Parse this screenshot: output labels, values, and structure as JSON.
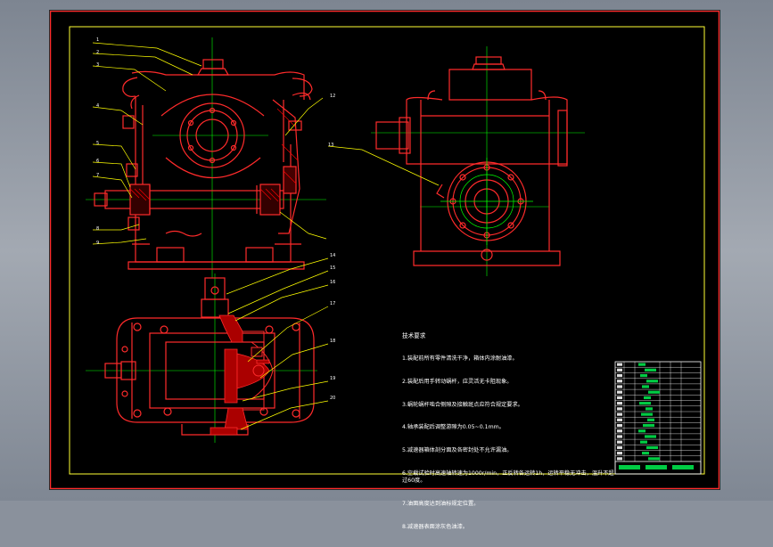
{
  "window": {
    "background": "#8a919c",
    "sheet_color": "#000000",
    "frame_color": "#ff2b2b",
    "border_color": "#ffff33"
  },
  "drawing": {
    "line_colors": {
      "outline": "#ff2b2b",
      "center": "#00ff00",
      "leader": "#ffff00",
      "hatch": "#ff0000",
      "text": "#ffffff"
    }
  },
  "part_numbers_front": [
    "1",
    "2",
    "3",
    "4",
    "5",
    "6",
    "7",
    "8",
    "9"
  ],
  "part_numbers_right": [
    "12",
    "13"
  ],
  "part_numbers_top": [
    "14",
    "15",
    "16",
    "17",
    "18",
    "19",
    "20"
  ],
  "notes": {
    "title": "技术要求",
    "lines": [
      "1.装配前所有零件清洗干净，箱体内涂耐油漆。",
      "2.装配后用手转动蜗杆，应灵活无卡阻现象。",
      "3.蜗轮蜗杆啮合侧隙及接触斑点应符合规定要求。",
      "4.轴承装配后调整游隙为0.05~0.1mm。",
      "5.减速器箱体剖分面及各密封处不允许漏油。",
      "6.空载试验时高速轴转速为1000r/min，正反转各运转1h，运转平稳无冲击，温升不超过60度。",
      "7.油面高度达到油标规定位置。",
      "8.减速器表面涂灰色油漆。"
    ]
  },
  "title_block": {
    "rows": 18
  }
}
